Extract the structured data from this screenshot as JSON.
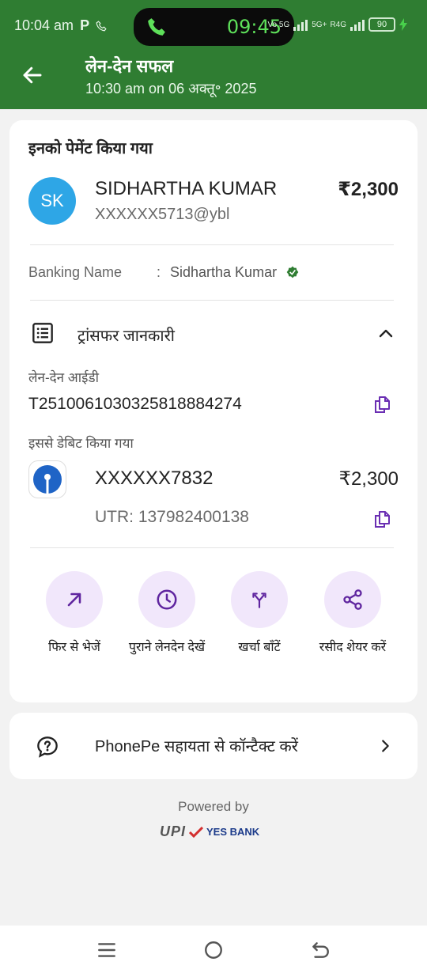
{
  "status_bar": {
    "time": "10:04 am",
    "app_badge": "P",
    "call_timer": "09:45",
    "network_1": "Vo 5G",
    "network_2": "5G+",
    "network_3": "R4G",
    "battery": "90"
  },
  "header": {
    "title": "लेन-देन सफल",
    "subtitle": "10:30 am on 06 अक्तू॰ 2025"
  },
  "payment": {
    "section_title": "इनको पेमेंट किया गया",
    "avatar_initials": "SK",
    "payee_name": "SIDHARTHA KUMAR",
    "payee_vpa": "XXXXXX5713@ybl",
    "amount": "₹2,300",
    "banking_name_label": "Banking Name",
    "banking_name_sep": ":",
    "banking_name_value": "Sidhartha Kumar"
  },
  "transfer": {
    "label": "ट्रांसफर जानकारी",
    "txn_id_label": "लेन-देन आईडी",
    "txn_id": "T2510061030325818884274",
    "debited_label": "इससे डेबिट किया गया",
    "account": "XXXXXX7832",
    "account_amount": "₹2,300",
    "utr": "UTR: 137982400138"
  },
  "actions": [
    {
      "label": "फिर से भेजें",
      "icon": "arrow-up-right-icon"
    },
    {
      "label": "पुराने लेनदेन देखें",
      "icon": "clock-icon"
    },
    {
      "label": "खर्चा बाँटें",
      "icon": "split-icon"
    },
    {
      "label": "रसीद शेयर करें",
      "icon": "share-icon"
    }
  ],
  "help": {
    "label": "PhonePe सहायता से कॉन्टैक्ट करें"
  },
  "footer": {
    "powered_by": "Powered by",
    "upi": "UPI",
    "bank": "YES BANK"
  },
  "colors": {
    "header_green": "#2f7d32",
    "accent_purple": "#5f259f",
    "action_bg": "#f1e7fb",
    "avatar_blue": "#2ea6e6",
    "verified_green": "#2f7d32"
  }
}
